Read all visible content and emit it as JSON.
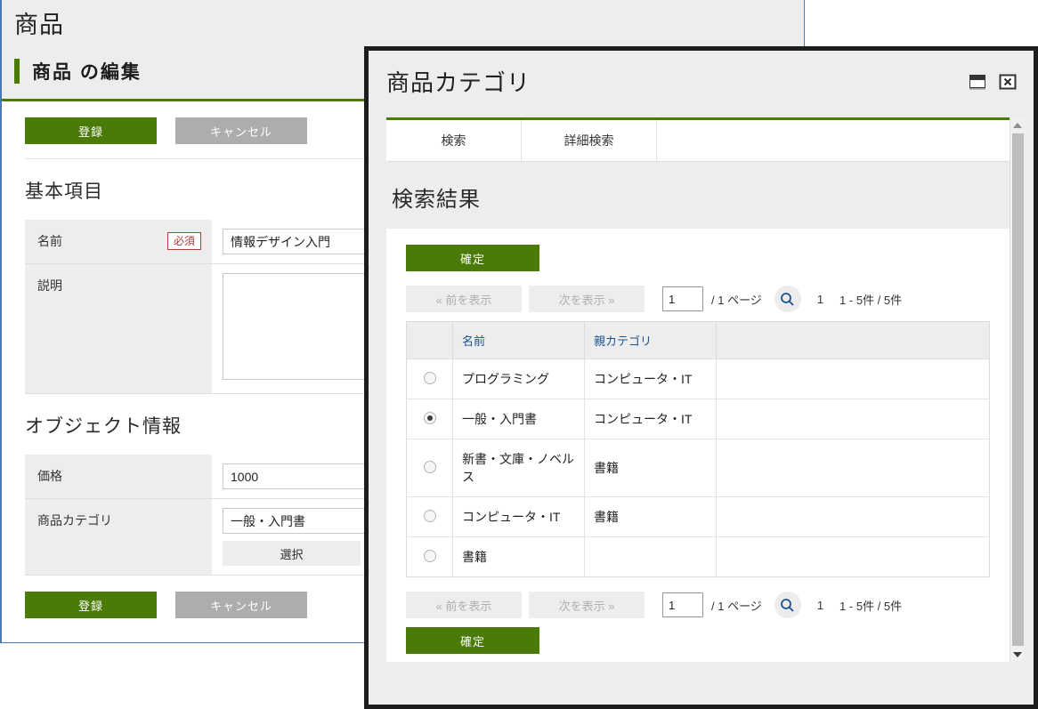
{
  "background_window": {
    "app_title": "商品",
    "page_title": "商品 の編集",
    "top_buttons": {
      "submit": "登録",
      "cancel": "キャンセル"
    },
    "bottom_buttons": {
      "submit": "登録",
      "cancel": "キャンセル"
    },
    "sections": [
      {
        "heading": "基本項目",
        "fields": [
          {
            "label": "名前",
            "required_badge": "必須",
            "value": "情報デザイン入門",
            "type": "text"
          },
          {
            "label": "説明",
            "required_badge": "",
            "value": "",
            "type": "textarea"
          }
        ]
      },
      {
        "heading": "オブジェクト情報",
        "fields": [
          {
            "label": "価格",
            "required_badge": "",
            "value": "1000",
            "type": "text"
          },
          {
            "label": "商品カテゴリ",
            "required_badge": "",
            "value": "一般・入門書",
            "type": "text-with-buttons",
            "buttons": [
              "選択",
              ""
            ]
          }
        ]
      }
    ]
  },
  "modal": {
    "title": "商品カテゴリ",
    "window_controls": {
      "restore": "restore-window-icon",
      "close": "close-window-icon"
    },
    "tabs": [
      {
        "label": "検索",
        "active": true
      },
      {
        "label": "詳細検索",
        "active": false
      }
    ],
    "results_heading": "検索結果",
    "confirm_label": "確定",
    "pager": {
      "prev_label": "« 前を表示",
      "next_label": "次を表示 »",
      "page_input_value": "1",
      "page_of_text": "/ 1 ページ",
      "search_icon": "search-icon",
      "current_page_number": "1",
      "range_text": "1 - 5件 / 5件"
    },
    "table": {
      "columns": [
        "",
        "名前",
        "親カテゴリ",
        ""
      ],
      "rows": [
        {
          "selected": false,
          "name": "プログラミング",
          "parent": "コンピュータ・IT",
          "blank": ""
        },
        {
          "selected": true,
          "name": "一般・入門書",
          "parent": "コンピュータ・IT",
          "blank": ""
        },
        {
          "selected": false,
          "name": "新書・文庫・ノベルス",
          "parent": "書籍",
          "blank": ""
        },
        {
          "selected": false,
          "name": "コンピュータ・IT",
          "parent": "書籍",
          "blank": ""
        },
        {
          "selected": false,
          "name": "書籍",
          "parent": "",
          "blank": ""
        }
      ]
    }
  },
  "colors": {
    "accent_green": "#4a7a08",
    "cancel_gray": "#adadad",
    "required_red": "#b23b3b",
    "link_blue": "#1a5490",
    "window_border_blue": "#4a7ab5",
    "modal_border": "#1d1d1d"
  }
}
